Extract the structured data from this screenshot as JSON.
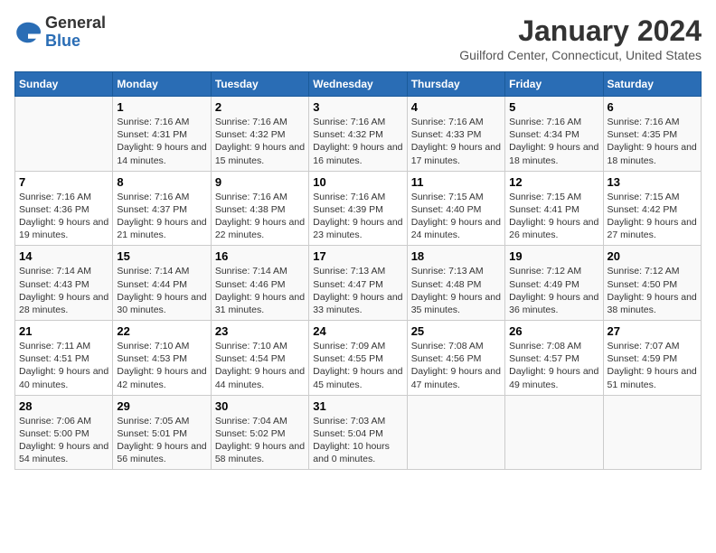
{
  "header": {
    "logo": {
      "general": "General",
      "blue": "Blue"
    },
    "title": "January 2024",
    "subtitle": "Guilford Center, Connecticut, United States"
  },
  "weekdays": [
    "Sunday",
    "Monday",
    "Tuesday",
    "Wednesday",
    "Thursday",
    "Friday",
    "Saturday"
  ],
  "weeks": [
    [
      {
        "day": "",
        "sunrise": "",
        "sunset": "",
        "daylight": ""
      },
      {
        "day": "1",
        "sunrise": "Sunrise: 7:16 AM",
        "sunset": "Sunset: 4:31 PM",
        "daylight": "Daylight: 9 hours and 14 minutes."
      },
      {
        "day": "2",
        "sunrise": "Sunrise: 7:16 AM",
        "sunset": "Sunset: 4:32 PM",
        "daylight": "Daylight: 9 hours and 15 minutes."
      },
      {
        "day": "3",
        "sunrise": "Sunrise: 7:16 AM",
        "sunset": "Sunset: 4:32 PM",
        "daylight": "Daylight: 9 hours and 16 minutes."
      },
      {
        "day": "4",
        "sunrise": "Sunrise: 7:16 AM",
        "sunset": "Sunset: 4:33 PM",
        "daylight": "Daylight: 9 hours and 17 minutes."
      },
      {
        "day": "5",
        "sunrise": "Sunrise: 7:16 AM",
        "sunset": "Sunset: 4:34 PM",
        "daylight": "Daylight: 9 hours and 18 minutes."
      },
      {
        "day": "6",
        "sunrise": "Sunrise: 7:16 AM",
        "sunset": "Sunset: 4:35 PM",
        "daylight": "Daylight: 9 hours and 18 minutes."
      }
    ],
    [
      {
        "day": "7",
        "sunrise": "Sunrise: 7:16 AM",
        "sunset": "Sunset: 4:36 PM",
        "daylight": "Daylight: 9 hours and 19 minutes."
      },
      {
        "day": "8",
        "sunrise": "Sunrise: 7:16 AM",
        "sunset": "Sunset: 4:37 PM",
        "daylight": "Daylight: 9 hours and 21 minutes."
      },
      {
        "day": "9",
        "sunrise": "Sunrise: 7:16 AM",
        "sunset": "Sunset: 4:38 PM",
        "daylight": "Daylight: 9 hours and 22 minutes."
      },
      {
        "day": "10",
        "sunrise": "Sunrise: 7:16 AM",
        "sunset": "Sunset: 4:39 PM",
        "daylight": "Daylight: 9 hours and 23 minutes."
      },
      {
        "day": "11",
        "sunrise": "Sunrise: 7:15 AM",
        "sunset": "Sunset: 4:40 PM",
        "daylight": "Daylight: 9 hours and 24 minutes."
      },
      {
        "day": "12",
        "sunrise": "Sunrise: 7:15 AM",
        "sunset": "Sunset: 4:41 PM",
        "daylight": "Daylight: 9 hours and 26 minutes."
      },
      {
        "day": "13",
        "sunrise": "Sunrise: 7:15 AM",
        "sunset": "Sunset: 4:42 PM",
        "daylight": "Daylight: 9 hours and 27 minutes."
      }
    ],
    [
      {
        "day": "14",
        "sunrise": "Sunrise: 7:14 AM",
        "sunset": "Sunset: 4:43 PM",
        "daylight": "Daylight: 9 hours and 28 minutes."
      },
      {
        "day": "15",
        "sunrise": "Sunrise: 7:14 AM",
        "sunset": "Sunset: 4:44 PM",
        "daylight": "Daylight: 9 hours and 30 minutes."
      },
      {
        "day": "16",
        "sunrise": "Sunrise: 7:14 AM",
        "sunset": "Sunset: 4:46 PM",
        "daylight": "Daylight: 9 hours and 31 minutes."
      },
      {
        "day": "17",
        "sunrise": "Sunrise: 7:13 AM",
        "sunset": "Sunset: 4:47 PM",
        "daylight": "Daylight: 9 hours and 33 minutes."
      },
      {
        "day": "18",
        "sunrise": "Sunrise: 7:13 AM",
        "sunset": "Sunset: 4:48 PM",
        "daylight": "Daylight: 9 hours and 35 minutes."
      },
      {
        "day": "19",
        "sunrise": "Sunrise: 7:12 AM",
        "sunset": "Sunset: 4:49 PM",
        "daylight": "Daylight: 9 hours and 36 minutes."
      },
      {
        "day": "20",
        "sunrise": "Sunrise: 7:12 AM",
        "sunset": "Sunset: 4:50 PM",
        "daylight": "Daylight: 9 hours and 38 minutes."
      }
    ],
    [
      {
        "day": "21",
        "sunrise": "Sunrise: 7:11 AM",
        "sunset": "Sunset: 4:51 PM",
        "daylight": "Daylight: 9 hours and 40 minutes."
      },
      {
        "day": "22",
        "sunrise": "Sunrise: 7:10 AM",
        "sunset": "Sunset: 4:53 PM",
        "daylight": "Daylight: 9 hours and 42 minutes."
      },
      {
        "day": "23",
        "sunrise": "Sunrise: 7:10 AM",
        "sunset": "Sunset: 4:54 PM",
        "daylight": "Daylight: 9 hours and 44 minutes."
      },
      {
        "day": "24",
        "sunrise": "Sunrise: 7:09 AM",
        "sunset": "Sunset: 4:55 PM",
        "daylight": "Daylight: 9 hours and 45 minutes."
      },
      {
        "day": "25",
        "sunrise": "Sunrise: 7:08 AM",
        "sunset": "Sunset: 4:56 PM",
        "daylight": "Daylight: 9 hours and 47 minutes."
      },
      {
        "day": "26",
        "sunrise": "Sunrise: 7:08 AM",
        "sunset": "Sunset: 4:57 PM",
        "daylight": "Daylight: 9 hours and 49 minutes."
      },
      {
        "day": "27",
        "sunrise": "Sunrise: 7:07 AM",
        "sunset": "Sunset: 4:59 PM",
        "daylight": "Daylight: 9 hours and 51 minutes."
      }
    ],
    [
      {
        "day": "28",
        "sunrise": "Sunrise: 7:06 AM",
        "sunset": "Sunset: 5:00 PM",
        "daylight": "Daylight: 9 hours and 54 minutes."
      },
      {
        "day": "29",
        "sunrise": "Sunrise: 7:05 AM",
        "sunset": "Sunset: 5:01 PM",
        "daylight": "Daylight: 9 hours and 56 minutes."
      },
      {
        "day": "30",
        "sunrise": "Sunrise: 7:04 AM",
        "sunset": "Sunset: 5:02 PM",
        "daylight": "Daylight: 9 hours and 58 minutes."
      },
      {
        "day": "31",
        "sunrise": "Sunrise: 7:03 AM",
        "sunset": "Sunset: 5:04 PM",
        "daylight": "Daylight: 10 hours and 0 minutes."
      },
      {
        "day": "",
        "sunrise": "",
        "sunset": "",
        "daylight": ""
      },
      {
        "day": "",
        "sunrise": "",
        "sunset": "",
        "daylight": ""
      },
      {
        "day": "",
        "sunrise": "",
        "sunset": "",
        "daylight": ""
      }
    ]
  ]
}
